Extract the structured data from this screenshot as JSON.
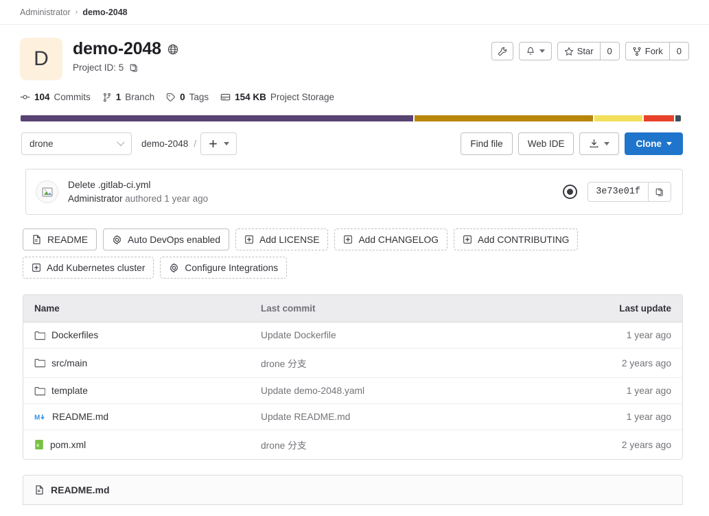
{
  "breadcrumb": {
    "owner": "Administrator",
    "separator": "›",
    "project": "demo-2048"
  },
  "project": {
    "avatar_letter": "D",
    "name": "demo-2048",
    "visibility_icon": "globe-icon",
    "project_id_label": "Project ID: 5",
    "copy_icon": "copy-icon"
  },
  "header_actions": {
    "wrench_icon": "wrench-icon",
    "notification_icon": "bell-icon",
    "star_label": "Star",
    "star_count": "0",
    "fork_label": "Fork",
    "fork_count": "0"
  },
  "stats": [
    {
      "icon": "commit-icon",
      "value": "104",
      "label": "Commits"
    },
    {
      "icon": "branch-icon",
      "value": "1",
      "label": "Branch"
    },
    {
      "icon": "tag-icon",
      "value": "0",
      "label": "Tags"
    },
    {
      "icon": "storage-icon",
      "value": "154 KB",
      "label": "Project Storage"
    }
  ],
  "language_bar": [
    {
      "name": "lang-1",
      "color": "#584373",
      "pct": 60.0
    },
    {
      "name": "lang-2",
      "color": "#b8860b",
      "pct": 27.2
    },
    {
      "name": "lang-3",
      "color": "#f2e05b",
      "pct": 7.4
    },
    {
      "name": "lang-4",
      "color": "#e8412a",
      "pct": 4.6
    },
    {
      "name": "lang-5",
      "color": "#3c5159",
      "pct": 0.8
    }
  ],
  "toolbar": {
    "branch": "drone",
    "path_root": "demo-2048",
    "path_separator": "/",
    "add_icon": "plus-icon",
    "find_file": "Find file",
    "web_ide": "Web IDE",
    "download_icon": "download-icon",
    "clone": "Clone"
  },
  "commit": {
    "avatar_icon": "broken-image-icon",
    "title": "Delete .gitlab-ci.yml",
    "author": "Administrator",
    "authored_text": "authored 1 year ago",
    "status_icon": "pipeline-status-icon",
    "sha": "3e73e01f",
    "copy_icon": "copy-icon"
  },
  "quick_actions": [
    {
      "icon": "file-icon",
      "label": "README",
      "dashed": false
    },
    {
      "icon": "gear-icon",
      "label": "Auto DevOps enabled",
      "dashed": false
    },
    {
      "icon": "plus-box-icon",
      "label": "Add LICENSE",
      "dashed": true
    },
    {
      "icon": "plus-box-icon",
      "label": "Add CHANGELOG",
      "dashed": true
    },
    {
      "icon": "plus-box-icon",
      "label": "Add CONTRIBUTING",
      "dashed": true
    },
    {
      "icon": "plus-box-icon",
      "label": "Add Kubernetes cluster",
      "dashed": true
    },
    {
      "icon": "gear-icon",
      "label": "Configure Integrations",
      "dashed": true
    }
  ],
  "tree": {
    "headers": {
      "name": "Name",
      "last_commit": "Last commit",
      "last_update": "Last update"
    },
    "rows": [
      {
        "icon": "folder-icon",
        "name": "Dockerfiles",
        "last_commit": "Update Dockerfile",
        "last_update": "1 year ago"
      },
      {
        "icon": "folder-icon",
        "name": "src/main",
        "last_commit": "drone 分支",
        "last_update": "2 years ago"
      },
      {
        "icon": "folder-icon",
        "name": "template",
        "last_commit": "Update demo-2048.yaml",
        "last_update": "1 year ago"
      },
      {
        "icon": "markdown-icon",
        "name": "README.md",
        "last_commit": "Update README.md",
        "last_update": "1 year ago"
      },
      {
        "icon": "xml-file-icon",
        "name": "pom.xml",
        "last_commit": "drone 分支",
        "last_update": "2 years ago"
      }
    ]
  },
  "readme_card": {
    "icon": "file-icon",
    "title": "README.md"
  }
}
